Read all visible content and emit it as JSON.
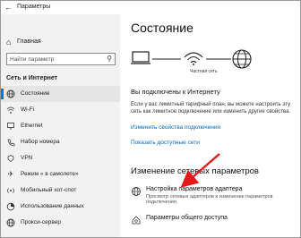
{
  "window": {
    "title": "Параметры"
  },
  "sidebar": {
    "home_label": "Главная",
    "search_placeholder": "Найти параметр",
    "section_label": "Сеть и Интернет",
    "items": [
      {
        "label": "Состояние",
        "icon": "globe-icon"
      },
      {
        "label": "Wi-Fi",
        "icon": "wifi-icon"
      },
      {
        "label": "Ethernet",
        "icon": "ethernet-icon"
      },
      {
        "label": "Набор номера",
        "icon": "phone-icon"
      },
      {
        "label": "VPN",
        "icon": "vpn-icon"
      },
      {
        "label": "Режим « в самолете»",
        "icon": "airplane-icon"
      },
      {
        "label": "Мобильный хот-спот",
        "icon": "hotspot-icon"
      },
      {
        "label": "Использование данных",
        "icon": "data-usage-icon"
      },
      {
        "label": "Прокси-сервер",
        "icon": "globe-icon"
      }
    ]
  },
  "main": {
    "title": "Состояние",
    "network_caption": "Частная сеть",
    "status_heading": "Вы подключены к Интернету",
    "status_desc": "Если у вас лимитный тарифный план, вы можете настроить эту сеть как лимитное подключение или изменить другие свойства.",
    "link_change": "Изменить свойства подключения",
    "link_show": "Показать доступные сети",
    "section_heading": "Изменение сетевых параметров",
    "options": [
      {
        "title": "Настройка параметров адаптера",
        "desc": "Просмотр сетевых адаптеров и изменение параметров подключения."
      },
      {
        "title": "Параметры общего доступа",
        "desc": ""
      }
    ]
  }
}
